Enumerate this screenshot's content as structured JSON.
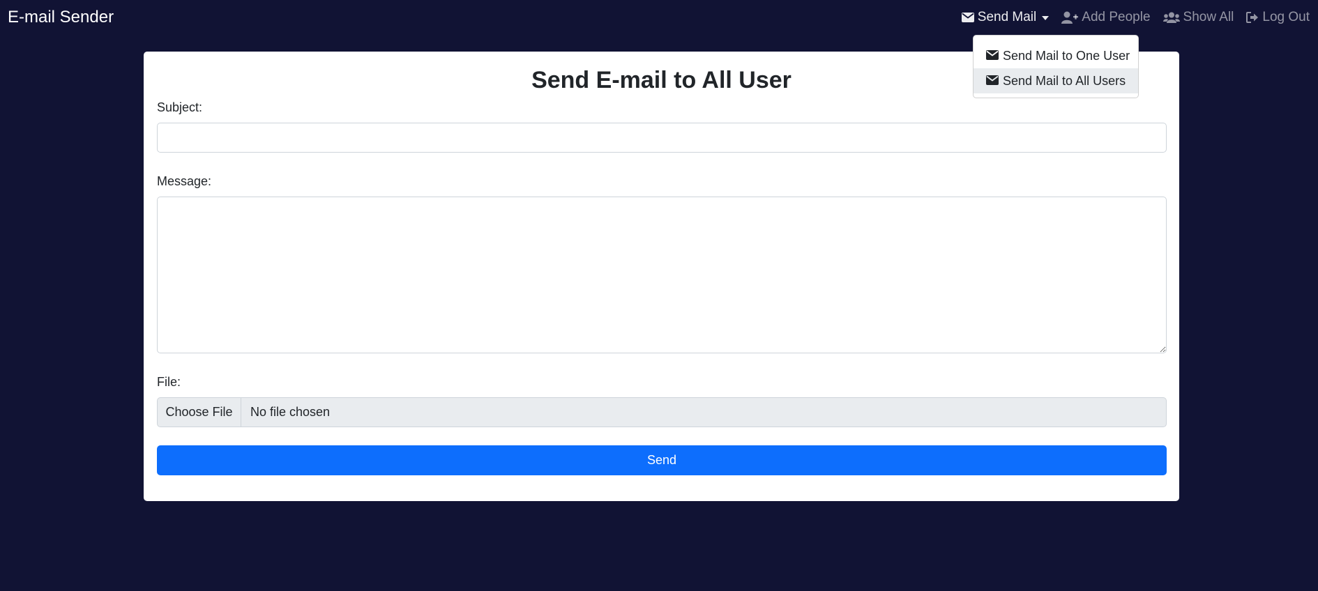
{
  "navbar": {
    "brand": "E-mail Sender",
    "links": {
      "send_mail": "Send Mail",
      "add_people": "Add People",
      "show_all": "Show All",
      "log_out": "Log Out"
    }
  },
  "dropdown": {
    "items": [
      {
        "label": "Send Mail to One User",
        "icon": "envelope-icon"
      },
      {
        "label": "Send Mail to All Users",
        "icon": "envelope-icon"
      }
    ]
  },
  "form": {
    "title": "Send E-mail to All User",
    "subject_label": "Subject:",
    "subject_value": "",
    "message_label": "Message:",
    "message_value": "",
    "file_label": "File:",
    "file_button": "Choose File",
    "file_status": "No file chosen",
    "send_label": "Send"
  },
  "colors": {
    "background": "#111334",
    "primary": "#0d6efd",
    "dropdown_hover": "#e9ecef"
  }
}
